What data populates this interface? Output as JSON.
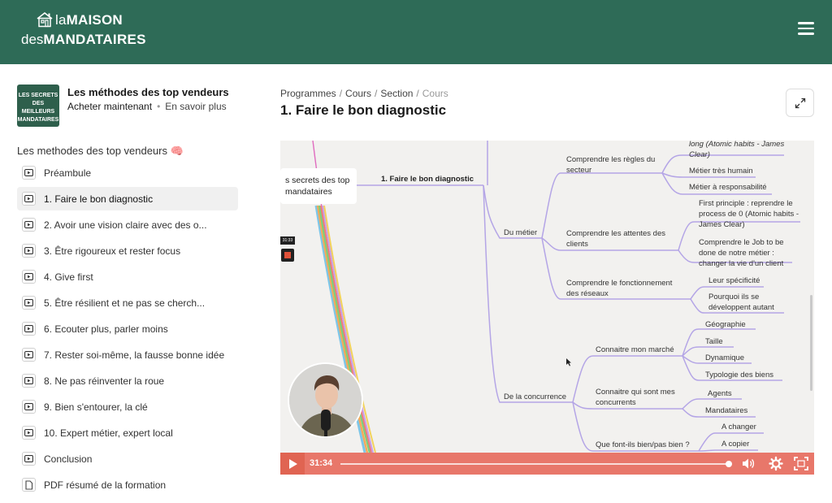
{
  "header": {
    "logo_line1_thin": "la",
    "logo_line1_bold": "MAISON",
    "logo_line2_thin": "des",
    "logo_line2_bold": "MANDATAIRES",
    "accent_color": "#2e6b57"
  },
  "course": {
    "thumb_text": "LES SECRETS DES MEILLEURS MANDATAIRES",
    "title": "Les méthodes des top vendeurs",
    "buy_label": "Acheter maintenant",
    "separator": "•",
    "more_label": "En savoir plus"
  },
  "sidebar": {
    "section_title": "Les methodes des top vendeurs 🧠",
    "lessons": [
      {
        "label": "Préambule",
        "icon": "video-icon"
      },
      {
        "label": "1. Faire le bon diagnostic",
        "icon": "video-icon",
        "active": true
      },
      {
        "label": "2. Avoir une vision claire avec des o...",
        "icon": "video-icon"
      },
      {
        "label": "3. Être rigoureux et rester focus",
        "icon": "video-icon"
      },
      {
        "label": "4. Give first",
        "icon": "video-icon"
      },
      {
        "label": "5. Être résilient et ne pas se cherch...",
        "icon": "video-icon"
      },
      {
        "label": "6. Ecouter plus, parler moins",
        "icon": "video-icon"
      },
      {
        "label": "7. Rester soi-même, la fausse bonne idée",
        "icon": "video-icon"
      },
      {
        "label": "8. Ne pas réinventer la roue",
        "icon": "video-icon"
      },
      {
        "label": "9. Bien s'entourer, la clé",
        "icon": "video-icon"
      },
      {
        "label": "10. Expert métier, expert local",
        "icon": "video-icon"
      },
      {
        "label": "Conclusion",
        "icon": "video-icon"
      },
      {
        "label": "PDF résumé de la formation",
        "icon": "document-icon"
      }
    ]
  },
  "main": {
    "breadcrumb": [
      "Programmes",
      "Cours",
      "Section",
      "Cours"
    ],
    "title": "1. Faire le bon diagnostic"
  },
  "video": {
    "node_box": "s secrets des top\nmandataires",
    "main_node": "1. Faire le bon diagnostic",
    "mini_time": "31:33",
    "time": "31:34",
    "controls_color": "#e8776a",
    "mindmap": {
      "du_metier": "Du métier",
      "regles": "Comprendre les règles du\nsecteur",
      "long": "long (Atomic habits - James\nClear)",
      "humain": "Métier très humain",
      "responsabilite": "Métier à responsabilité",
      "attentes": "Comprendre les attentes des\nclients",
      "first_principle": "First principle : reprendre le\nprocess de 0 (Atomic habits -\nJames Clear)",
      "job": "Comprendre le Job to be\ndone de notre métier :\nchanger la vie d'un client",
      "reseaux": "Comprendre le fonctionnement\ndes réseaux",
      "specificite": "Leur spécificité",
      "pourquoi": "Pourquoi ils se\ndéveloppent autant",
      "concurrence": "De la concurrence",
      "marche": "Connaitre mon marché",
      "geographie": "Géographie",
      "taille": "Taille",
      "dynamique": "Dynamique",
      "typologie": "Typologie des biens",
      "concurrents": "Connaitre qui sont mes\nconcurrents",
      "agents": "Agents",
      "mandataires": "Mandataires",
      "font_ils": "Que font-ils bien/pas bien ?",
      "changer": "A changer",
      "copier": "A copier"
    }
  }
}
